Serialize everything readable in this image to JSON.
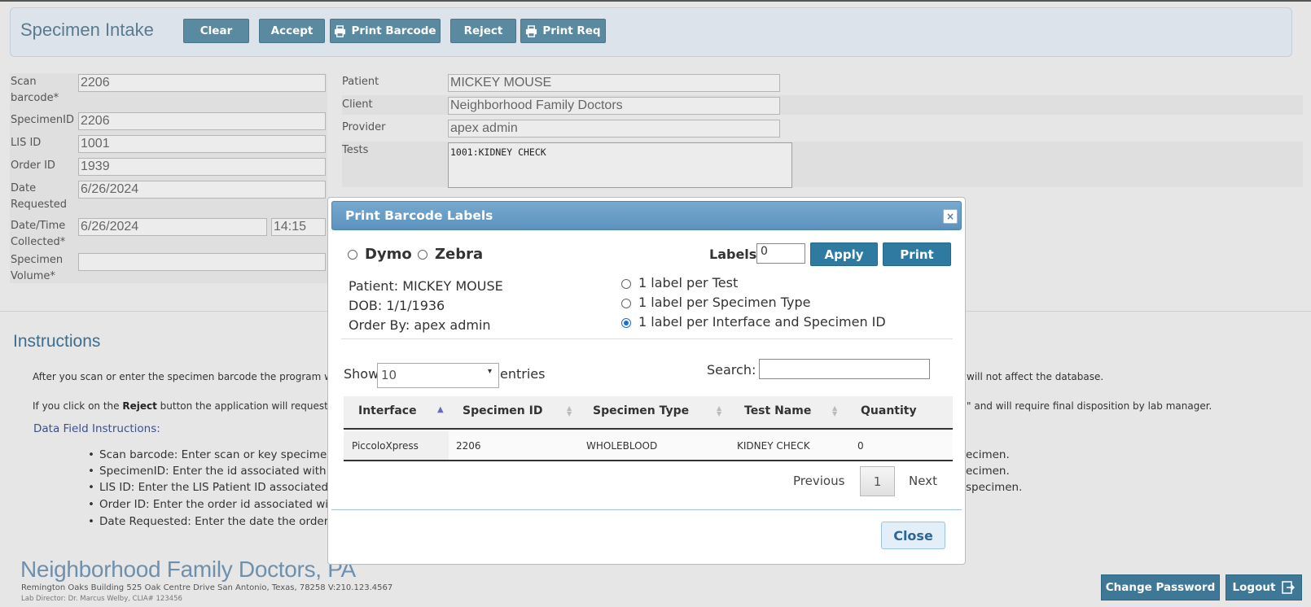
{
  "header": {
    "title": "Specimen Intake",
    "buttons": {
      "clear": "Clear",
      "accept": "Accept",
      "print_barcode": "Print Barcode",
      "reject": "Reject",
      "print_req": "Print Req"
    }
  },
  "form": {
    "scan_barcode": {
      "label": "Scan barcode*",
      "value": "2206"
    },
    "specimen_id": {
      "label": "SpecimenID",
      "value": "2206"
    },
    "lis_id": {
      "label": "LIS ID",
      "value": "1001"
    },
    "order_id": {
      "label": "Order ID",
      "value": "1939"
    },
    "date_requested": {
      "label": "Date Requested",
      "value": "6/26/2024"
    },
    "date_collected": {
      "label": "Date/Time Collected*",
      "date": "6/26/2024",
      "time": "14:15"
    },
    "specimen_volume": {
      "label": "Specimen Volume*",
      "value": ""
    },
    "patient": {
      "label": "Patient",
      "value": "MICKEY MOUSE"
    },
    "client": {
      "label": "Client",
      "value": "Neighborhood Family Doctors"
    },
    "provider": {
      "label": "Provider",
      "value": "apex admin"
    },
    "tests": {
      "label": "Tests",
      "value": "1001:KIDNEY CHECK"
    }
  },
  "instructions": {
    "title": "Instructions",
    "p1_start": "After you scan or enter the specimen barcode the program will dis",
    "p1_end": "will not affect the database.",
    "p2_start": "If you click on the ",
    "p2_bold": "Reject",
    "p2_mid": " button the application will request the yo",
    "p2_end": "\" and will require final disposition by lab manager.",
    "data_field_title": "Data Field Instructions:",
    "bullets": [
      {
        "start": "Scan barcode: Enter scan or key specimen",
        "end": "ecimen."
      },
      {
        "start": "SpecimenID: Enter the id associated with s",
        "end": "ecimen."
      },
      {
        "start": "LIS ID: Enter the LIS Patient ID associated",
        "end": "specimen."
      },
      {
        "start": "Order ID: Enter the order id associated wit",
        "end": ""
      },
      {
        "start": "Date Requested: Enter the date the order w",
        "end": ""
      }
    ]
  },
  "footer": {
    "org_name": "Neighborhood Family Doctors, PA",
    "address": "Remington Oaks Building 525 Oak Centre Drive San Antonio, Texas, 78258  V:210.123.4567",
    "director": "Lab Director: Dr. Marcus Welby, CLIA# 123456",
    "change_password": "Change Password",
    "logout": "Logout"
  },
  "modal": {
    "title": "Print Barcode Labels",
    "close_x": "×",
    "printer_dymo": "Dymo",
    "printer_zebra": "Zebra",
    "labels_label": "Labels",
    "labels_value": "0",
    "apply": "Apply",
    "print": "Print",
    "patient": "Patient: MICKEY MOUSE",
    "dob": "DOB: 1/1/1936",
    "order_by": "Order By: apex admin",
    "options": [
      "1 label per Test",
      "1 label per Specimen Type",
      "1 label per Interface and Specimen ID"
    ],
    "selected_option": 2,
    "show": "Show",
    "entries_value": "10",
    "entries": "entries",
    "search_label": "Search:",
    "search_value": "",
    "columns": [
      "Interface",
      "Specimen ID",
      "Specimen Type",
      "Test Name",
      "Quantity"
    ],
    "rows": [
      [
        "PiccoloXpress",
        "2206",
        "WHOLEBLOOD",
        "KIDNEY CHECK",
        "0"
      ]
    ],
    "previous": "Previous",
    "page": "1",
    "next": "Next",
    "close": "Close"
  }
}
